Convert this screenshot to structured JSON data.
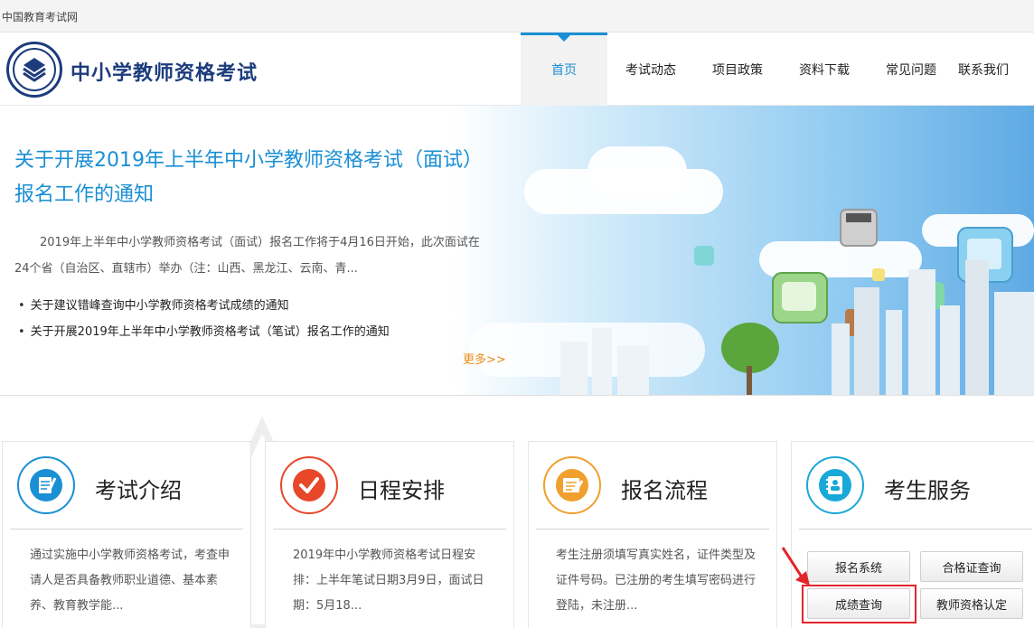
{
  "topbar": {
    "site_name": "中国教育考试网"
  },
  "header": {
    "brand": "中小学教师资格考试",
    "nav": [
      {
        "label": "首页"
      },
      {
        "label": "考试动态"
      },
      {
        "label": "项目政策"
      },
      {
        "label": "资料下载"
      },
      {
        "label": "常见问题"
      },
      {
        "label": "联系我们"
      }
    ]
  },
  "banner": {
    "headline": "关于开展2019年上半年中小学教师资格考试（面试）报名工作的通知",
    "summary": "2019年上半年中小学教师资格考试（面试）报名工作将于4月16日开始，此次面试在24个省（自治区、直辖市）举办（注：山西、黑龙江、云南、青...",
    "news": [
      {
        "title": "关于建议错峰查询中小学教师资格考试成绩的通知"
      },
      {
        "title": "关于开展2019年上半年中小学教师资格考试（笔试）报名工作的通知"
      }
    ],
    "more": "更多>>"
  },
  "cards": [
    {
      "title": "考试介绍",
      "text": "通过实施中小学教师资格考试，考查申请人是否具备教师职业道德、基本素养、教育教学能...",
      "icon": "document-pen-icon",
      "color": "#1a8fd4"
    },
    {
      "title": "日程安排",
      "text": "2019年中小学教师资格考试日程安排：上半年笔试日期3月9日，面试日期：5月18...",
      "icon": "checkmark-icon",
      "color": "#e8472a"
    },
    {
      "title": "报名流程",
      "text": "考生注册须填写真实姓名，证件类型及证件号码。已注册的考生填写密码进行登陆，未注册...",
      "icon": "form-pen-icon",
      "color": "#f0a02e"
    },
    {
      "title": "考生服务",
      "icon": "contact-book-icon",
      "color": "#19a8d8"
    }
  ],
  "services": {
    "btn1": "报名系统",
    "btn2": "合格证查询",
    "btn3": "成绩查询",
    "btn4": "教师资格认定"
  }
}
